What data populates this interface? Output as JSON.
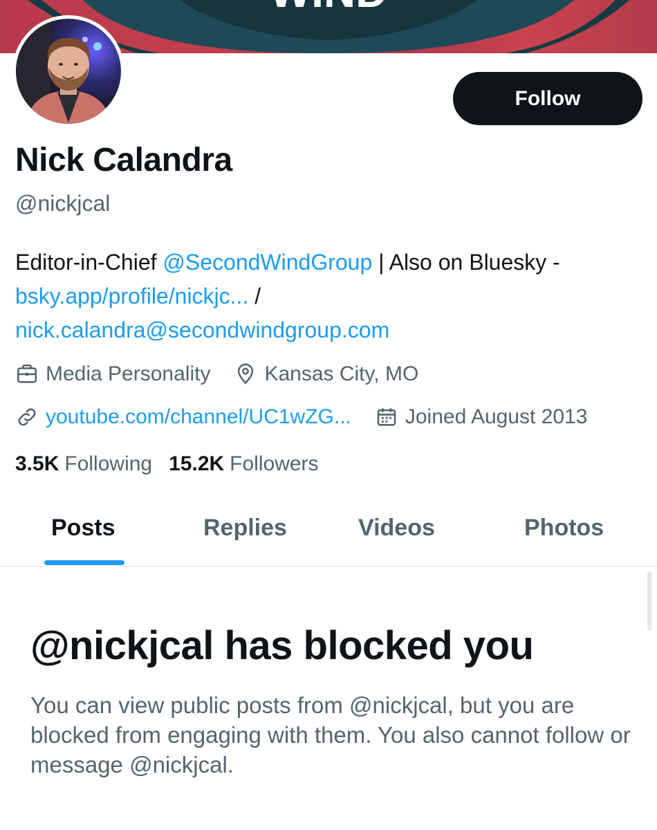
{
  "banner": {
    "wordmark": "WIND"
  },
  "profile": {
    "name": "Nick Calandra",
    "handle": "@nickjcal",
    "follow_label": "Follow",
    "bio": {
      "prefix": "Editor-in-Chief ",
      "mention": "@SecondWindGroup",
      "middle": " | Also on Bluesky - ",
      "bsky_link": "bsky.app/profile/nickjc...",
      "separator": " / ",
      "email_link": "nick.calandra@secondwindgroup.com"
    },
    "category": "Media Personality",
    "location": "Kansas City, MO",
    "website": "youtube.com/channel/UC1wZG...",
    "joined": "Joined August 2013",
    "following_count": "3.5K",
    "following_label": "Following",
    "followers_count": "15.2K",
    "followers_label": "Followers"
  },
  "tabs": [
    {
      "label": "Posts",
      "active": true
    },
    {
      "label": "Replies",
      "active": false
    },
    {
      "label": "Videos",
      "active": false
    },
    {
      "label": "Photos",
      "active": false
    }
  ],
  "blocked": {
    "title": "@nickjcal has blocked you",
    "message": "You can view public posts from @nickjcal, but you are blocked from engaging with them. You also cannot follow or message @nickjcal."
  },
  "icons": {
    "category": "briefcase-icon",
    "location": "map-pin-icon",
    "website": "link-icon",
    "joined": "calendar-icon"
  },
  "colors": {
    "accent": "#1d9bf0",
    "text": "#0f1419",
    "secondary": "#536471",
    "button": "#0f1419",
    "banner_red": "#b73a4a",
    "banner_teal": "#1e4a57"
  }
}
